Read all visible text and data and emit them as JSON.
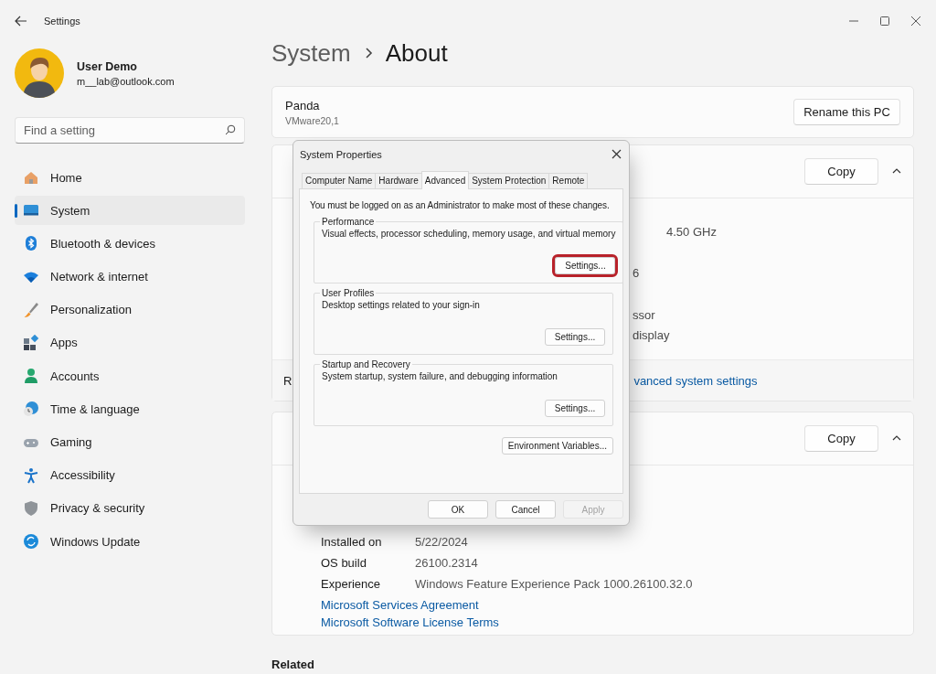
{
  "window": {
    "title": "Settings"
  },
  "account": {
    "name": "User Demo",
    "email": "m__lab@outlook.com"
  },
  "search": {
    "placeholder": "Find a setting"
  },
  "nav": [
    {
      "label": "Home",
      "kind": "home",
      "selected": false
    },
    {
      "label": "System",
      "kind": "system",
      "selected": true
    },
    {
      "label": "Bluetooth & devices",
      "kind": "bluetooth",
      "selected": false
    },
    {
      "label": "Network & internet",
      "kind": "network",
      "selected": false
    },
    {
      "label": "Personalization",
      "kind": "brush",
      "selected": false
    },
    {
      "label": "Apps",
      "kind": "apps",
      "selected": false
    },
    {
      "label": "Accounts",
      "kind": "accounts",
      "selected": false
    },
    {
      "label": "Time & language",
      "kind": "time",
      "selected": false
    },
    {
      "label": "Gaming",
      "kind": "gaming",
      "selected": false
    },
    {
      "label": "Accessibility",
      "kind": "accessibility",
      "selected": false
    },
    {
      "label": "Privacy & security",
      "kind": "privacy",
      "selected": false
    },
    {
      "label": "Windows Update",
      "kind": "update",
      "selected": false
    }
  ],
  "breadcrumb": {
    "parent": "System",
    "current": "About"
  },
  "device": {
    "name": "Panda",
    "model": "VMware20,1",
    "button": "Rename this PC"
  },
  "device_specs": {
    "button": "Copy",
    "expanded": true,
    "values": [
      "4.50 GHz",
      "6",
      "ssor",
      "display"
    ],
    "related_label": "R",
    "related_link": "vanced system settings"
  },
  "windows_specs": {
    "button": "Copy",
    "expanded": true,
    "rows": [
      {
        "label": "Installed on",
        "value": "5/22/2024"
      },
      {
        "label": "OS build",
        "value": "26100.2314"
      },
      {
        "label": "Experience",
        "value": "Windows Feature Experience Pack 1000.26100.32.0"
      }
    ],
    "links": [
      "Microsoft Services Agreement",
      "Microsoft Software License Terms"
    ]
  },
  "related": {
    "title": "Related"
  },
  "dialog": {
    "title": "System Properties",
    "tabs": [
      {
        "label": "Computer Name",
        "selected": false
      },
      {
        "label": "Hardware",
        "selected": false
      },
      {
        "label": "Advanced",
        "selected": true
      },
      {
        "label": "System Protection",
        "selected": false
      },
      {
        "label": "Remote",
        "selected": false
      }
    ],
    "notice": "You must be logged on as an Administrator to make most of these changes.",
    "groups": [
      {
        "title": "Performance",
        "description": "Visual effects, processor scheduling, memory usage, and virtual memory",
        "button": "Settings...",
        "highlighted": true
      },
      {
        "title": "User Profiles",
        "description": "Desktop settings related to your sign-in",
        "button": "Settings...",
        "highlighted": false
      },
      {
        "title": "Startup and Recovery",
        "description": "System startup, system failure, and debugging information",
        "button": "Settings...",
        "highlighted": false
      }
    ],
    "env_button": "Environment Variables...",
    "buttons": [
      {
        "label": "OK",
        "disabled": false
      },
      {
        "label": "Cancel",
        "disabled": false
      },
      {
        "label": "Apply",
        "disabled": true
      }
    ]
  }
}
